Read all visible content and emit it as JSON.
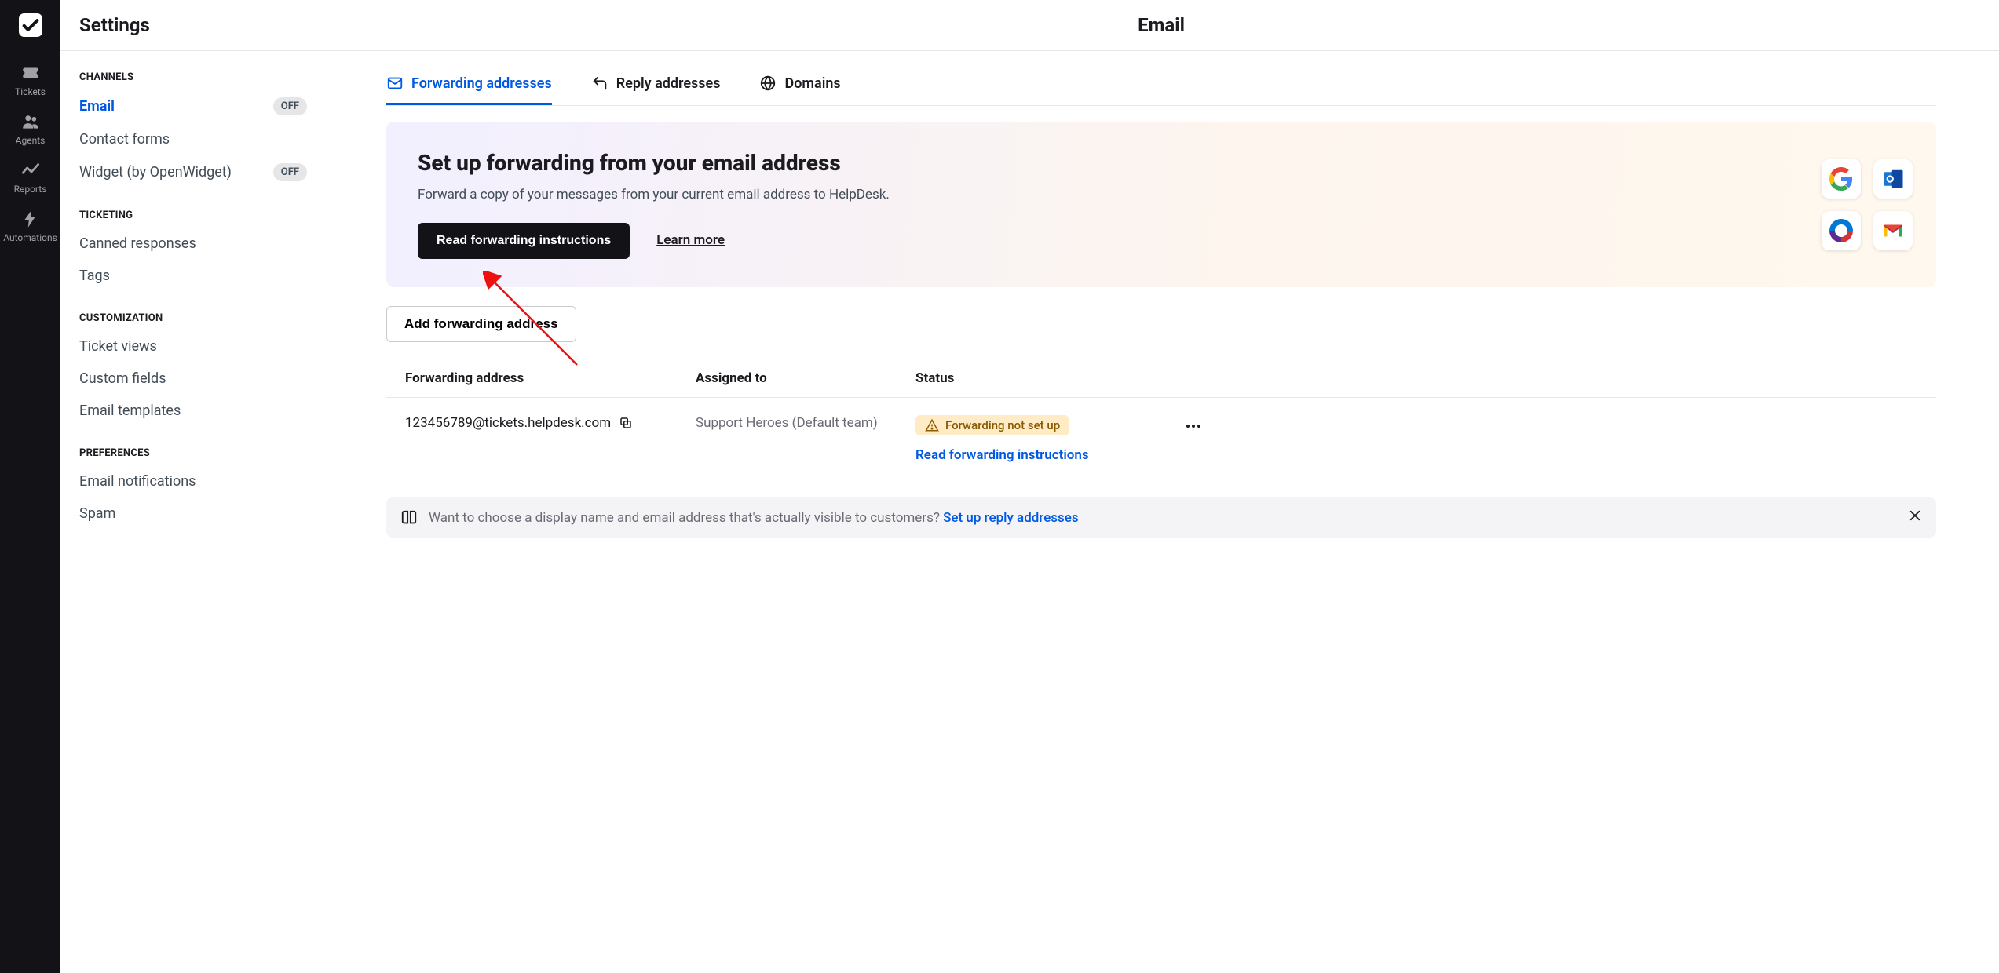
{
  "rail": {
    "items": [
      {
        "label": "Tickets"
      },
      {
        "label": "Agents"
      },
      {
        "label": "Reports"
      },
      {
        "label": "Automations"
      }
    ]
  },
  "sidebar": {
    "title": "Settings",
    "sections": {
      "channels": {
        "label": "CHANNELS",
        "items": [
          {
            "label": "Email",
            "badge": "OFF"
          },
          {
            "label": "Contact forms"
          },
          {
            "label": "Widget (by OpenWidget)",
            "badge": "OFF"
          }
        ]
      },
      "ticketing": {
        "label": "TICKETING",
        "items": [
          {
            "label": "Canned responses"
          },
          {
            "label": "Tags"
          }
        ]
      },
      "customization": {
        "label": "CUSTOMIZATION",
        "items": [
          {
            "label": "Ticket views"
          },
          {
            "label": "Custom fields"
          },
          {
            "label": "Email templates"
          }
        ]
      },
      "preferences": {
        "label": "PREFERENCES",
        "items": [
          {
            "label": "Email notifications"
          },
          {
            "label": "Spam"
          }
        ]
      }
    }
  },
  "page": {
    "title": "Email",
    "tabs": [
      {
        "label": "Forwarding addresses"
      },
      {
        "label": "Reply addresses"
      },
      {
        "label": "Domains"
      }
    ],
    "banner": {
      "title": "Set up forwarding from your email address",
      "subtitle": "Forward a copy of your messages from your current email address to HelpDesk.",
      "primary": "Read forwarding instructions",
      "secondary": "Learn more"
    },
    "add_button": "Add forwarding address",
    "table": {
      "cols": {
        "c1": "Forwarding address",
        "c2": "Assigned to",
        "c3": "Status"
      },
      "rows": [
        {
          "address": "123456789@tickets.helpdesk.com",
          "assigned": "Support Heroes (Default team)",
          "status_text": "Forwarding not set up",
          "status_link": "Read forwarding instructions"
        }
      ]
    },
    "tip": {
      "text": "Want to choose a display name and email address that's actually visible to customers? ",
      "link": "Set up reply addresses"
    }
  }
}
